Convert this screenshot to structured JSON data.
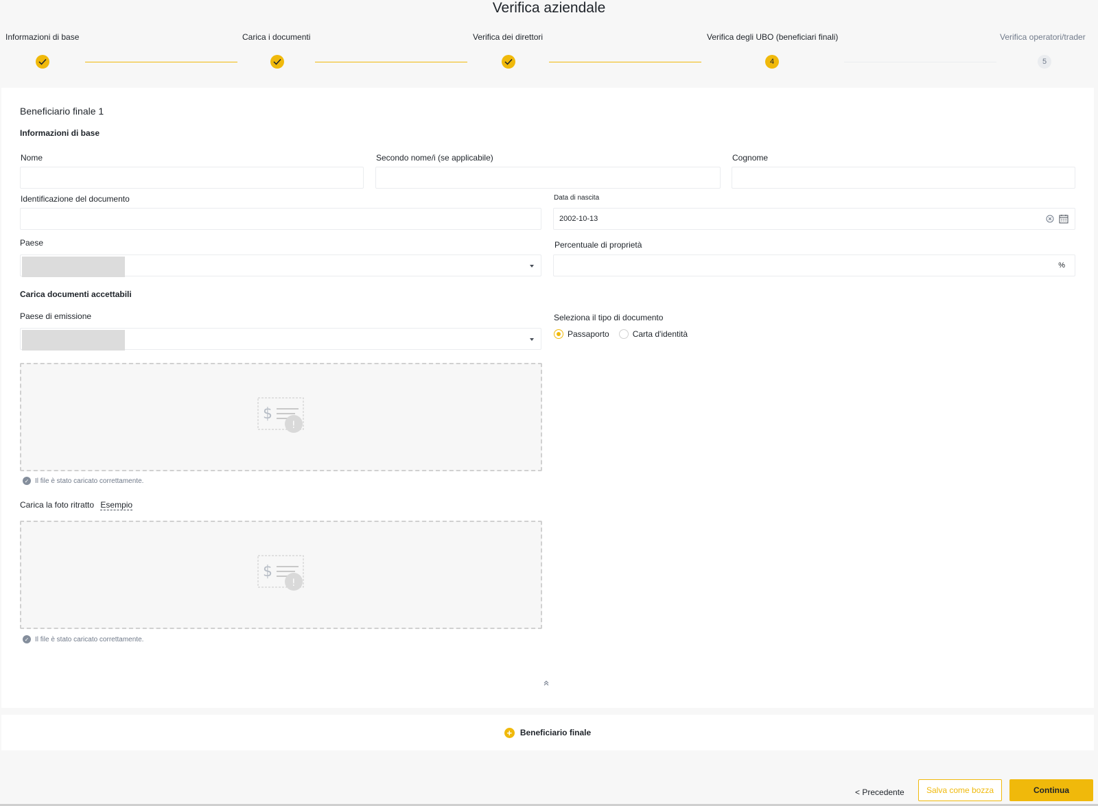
{
  "page": {
    "title": "Verifica aziendale"
  },
  "stepper": {
    "steps": [
      {
        "label": "Informazioni di base",
        "state": "done",
        "marker": ""
      },
      {
        "label": "Carica i documenti",
        "state": "done",
        "marker": ""
      },
      {
        "label": "Verifica dei direttori",
        "state": "done",
        "marker": ""
      },
      {
        "label": "Verifica degli UBO (beneficiari finali)",
        "state": "active",
        "marker": "4"
      },
      {
        "label": "Verifica operatori/trader",
        "state": "pending",
        "marker": "5"
      }
    ]
  },
  "form": {
    "section_title": "Beneficiario finale 1",
    "basic_info_title": "Informazioni di base",
    "first_name": {
      "label": "Nome",
      "value": ""
    },
    "middle_name": {
      "label": "Secondo nome/i (se applicabile)",
      "value": ""
    },
    "last_name": {
      "label": "Cognome",
      "value": ""
    },
    "document_id": {
      "label": "Identificazione del documento",
      "value": ""
    },
    "birth_date": {
      "label": "Data di nascita",
      "value": "2002-10-13"
    },
    "country": {
      "label": "Paese",
      "value": ""
    },
    "ownership": {
      "label": "Percentuale di proprietà",
      "value": "",
      "suffix": "%"
    },
    "upload_title": "Carica documenti accettabili",
    "issuing_country": {
      "label": "Paese di emissione",
      "value": ""
    },
    "doc_type": {
      "label": "Seleziona il tipo di documento",
      "options": [
        {
          "label": "Passaporto",
          "checked": true
        },
        {
          "label": "Carta d'identità",
          "checked": false
        }
      ]
    },
    "upload_note_1": "Il file è stato caricato correttamente.",
    "portrait": {
      "label": "Carica la foto ritratto",
      "example_link": "Esempio"
    },
    "upload_note_2": "Il file è stato caricato correttamente."
  },
  "add_beneficiary": {
    "label": "Beneficiario finale"
  },
  "footer": {
    "prev_label": "< Precedente",
    "draft_label": "Salva come bozza",
    "continue_label": "Continua"
  },
  "colors": {
    "accent": "#f0b90b",
    "text": "#1e2329",
    "muted": "#707a8a",
    "border": "#eaecef"
  }
}
